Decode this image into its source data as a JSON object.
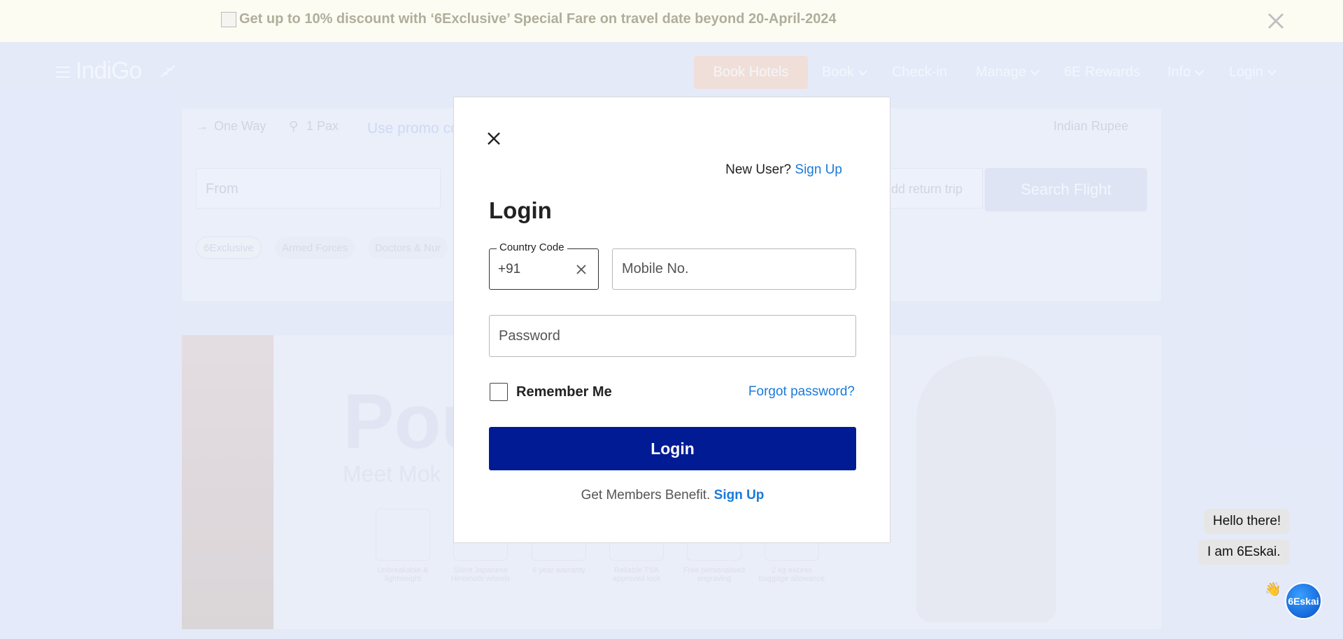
{
  "promo": {
    "text": "Get up to 10% discount with ‘6Exclusive’ Special Fare on travel date beyond 20-April-2024",
    "close_icon": "close-icon"
  },
  "nav": {
    "logo": "IndiGo",
    "book_hotels": "Book Hotels",
    "items": [
      {
        "label": "Book",
        "dropdown": true
      },
      {
        "label": "Check-in",
        "dropdown": false
      },
      {
        "label": "Manage",
        "dropdown": true
      },
      {
        "label": "6E Rewards",
        "dropdown": false
      },
      {
        "label": "Info",
        "dropdown": true
      },
      {
        "label": "Login",
        "dropdown": true
      }
    ]
  },
  "search": {
    "trip_type": "One Way",
    "pax": "1 Pax",
    "promo_hint": "Use promo co",
    "currency": "Indian Rupee",
    "from_placeholder": "From",
    "return_hint": "dd return trip",
    "search_button": "Search Flight",
    "fare_pills": [
      "6Exclusive",
      "Armed Forces",
      "Doctors & Nur"
    ]
  },
  "hero": {
    "headline": "Pou",
    "subline": "Meet Mok",
    "features": [
      "Unbreakable & lightweight",
      "Silent Japanese Hinomoto wheels",
      "6 year warranty",
      "Reliable TSA approved lock",
      "Free personalised engraving",
      "2 kg excess baggage allowance"
    ]
  },
  "login_modal": {
    "new_user_text": "New User?",
    "sign_up_link": "Sign Up",
    "title": "Login",
    "country_code_label": "Country Code",
    "country_code_value": "+91",
    "mobile_placeholder": "Mobile No.",
    "password_placeholder": "Password",
    "remember_me": "Remember Me",
    "remember_checked": false,
    "forgot_password": "Forgot password?",
    "login_button": "Login",
    "members_text": "Get Members Benefit.",
    "members_sign_up": "Sign Up"
  },
  "chat": {
    "greeting_1": "Hello there!",
    "greeting_2": "I am 6Eskai.",
    "wave": "👋",
    "avatar_label": "6Eskai"
  },
  "colors": {
    "primary_button": "#001b94",
    "link": "#1a7ad8",
    "book_hotels": "#fbdcc6"
  }
}
